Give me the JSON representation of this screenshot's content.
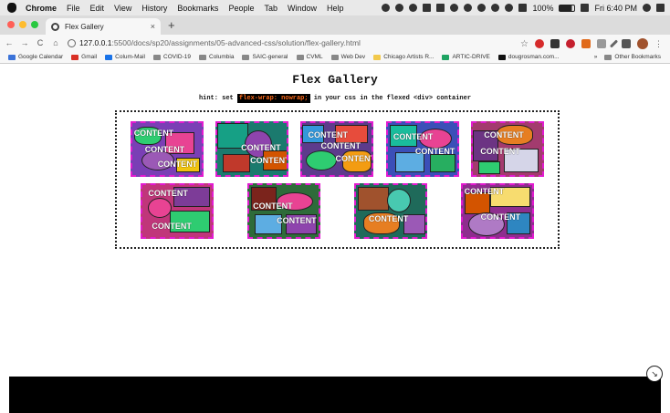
{
  "menubar": {
    "items": [
      "Chrome",
      "File",
      "Edit",
      "View",
      "History",
      "Bookmarks",
      "People",
      "Tab",
      "Window",
      "Help"
    ],
    "battery": "100%",
    "clock": "Fri 6:40 PM"
  },
  "tabbar": {
    "tab_title": "Flex Gallery",
    "close_glyph": "×",
    "new_tab_glyph": "+"
  },
  "toolbar": {
    "back_glyph": "←",
    "forward_glyph": "→",
    "reload_glyph": "C",
    "home_glyph": "⌂",
    "url_host": "127.0.0.1",
    "url_path": ":5500/docs/sp20/assignments/05-advanced-css/solution/flex-gallery.html",
    "menu_glyph": "⋮"
  },
  "bookmarks": {
    "items": [
      "Google Calendar",
      "Gmail",
      "Colum-Mail",
      "COVID-19",
      "Columbia",
      "SAIC-general",
      "CVML",
      "Web Dev",
      "Chicago Artists R...",
      "ARTIC-DRIVE",
      "dougrosman.com..."
    ],
    "more_glyph": "»",
    "other": "Other Bookmarks"
  },
  "page": {
    "title": "Flex Gallery",
    "hint_prefix": "hint: set ",
    "hint_code": "flex-wrap: nowrap;",
    "hint_suffix": " in your css in the flexed <div> container",
    "item_word": "CONTENT"
  },
  "colors": {
    "item_border": "#e21bd0",
    "hint_code_text": "#ff6b1a",
    "footer": "#000000"
  }
}
